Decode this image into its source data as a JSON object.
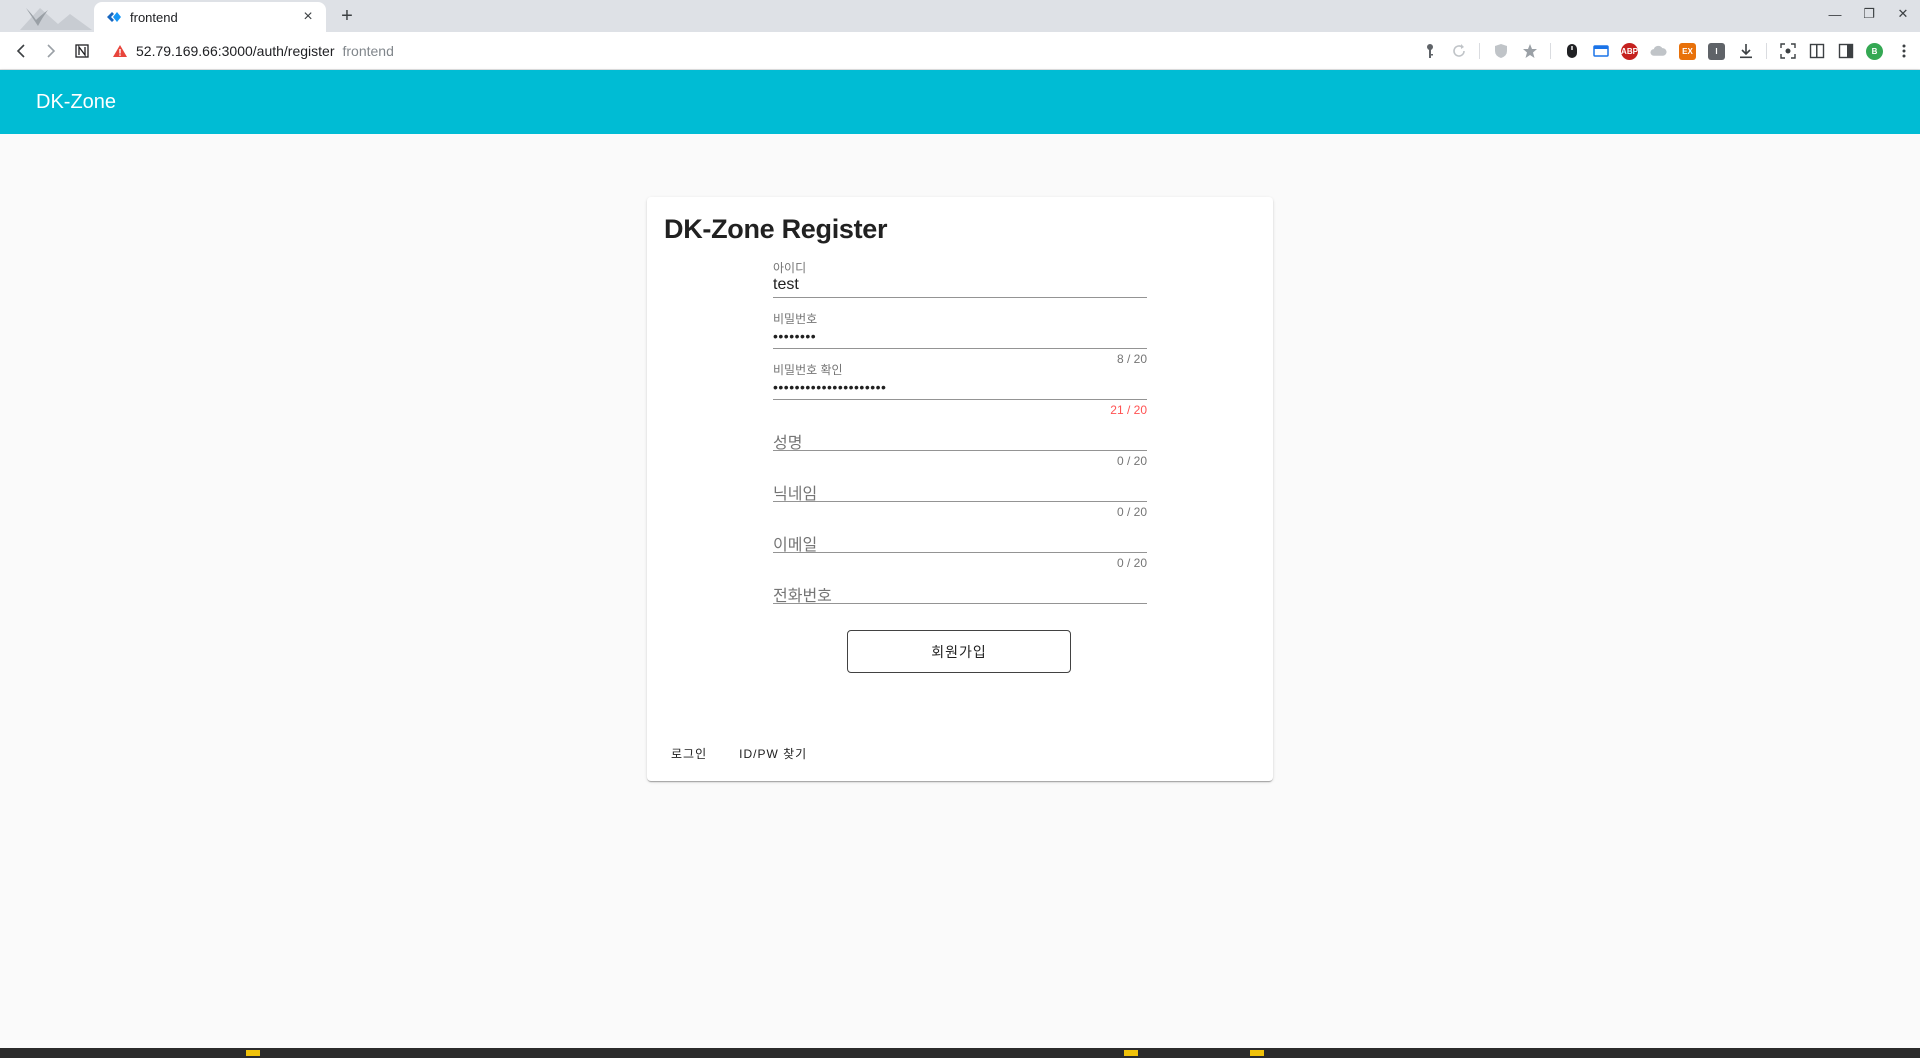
{
  "browser": {
    "tab": {
      "title": "frontend",
      "close": "×"
    },
    "new_tab": "+",
    "window_controls": {
      "minimize": "—",
      "restore": "❐",
      "close": "✕"
    },
    "address": {
      "url": "52.79.169.66:3000/auth/register",
      "page_title": "frontend"
    },
    "extensions": [
      "key-icon",
      "refresh-icon",
      "shield-icon",
      "star-icon",
      "mouse-icon",
      "window-icon",
      "abp",
      "cloud-icon",
      "ex",
      "i",
      "download-icon",
      "screenshot-icon",
      "reader-icon",
      "sidebar-icon",
      "profile-b"
    ],
    "ext_labels": {
      "abp": "ABP",
      "ex": "EX",
      "i": "I",
      "profile": "B"
    }
  },
  "app": {
    "title": "DK-Zone",
    "accent_color": "#00bcd4"
  },
  "register": {
    "title": "DK-Zone Register",
    "fields": [
      {
        "label": "아이디",
        "value": "test",
        "counter": ""
      },
      {
        "label": "비밀번호",
        "value": "••••••••",
        "counter": "8 / 20"
      },
      {
        "label": "비밀번호 확인",
        "value": "•••••••••••••••••••••",
        "counter": "21 / 20",
        "counter_state": "error"
      },
      {
        "label": "성명",
        "value": "",
        "counter": "0 / 20"
      },
      {
        "label": "닉네임",
        "value": "",
        "counter": "0 / 20"
      },
      {
        "label": "이메일",
        "value": "",
        "counter": "0 / 20"
      },
      {
        "label": "전화번호",
        "value": "",
        "counter": ""
      }
    ],
    "submit_label": "회원가입",
    "error_color": "#ff5252",
    "links": {
      "login": "로그인",
      "find": "ID/PW 찾기"
    }
  }
}
